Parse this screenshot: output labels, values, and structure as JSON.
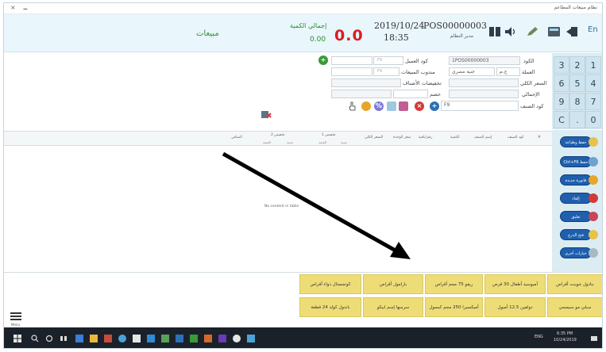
{
  "window": {
    "title": "نظام مبيعات المطاعم",
    "controls": [
      "×",
      "🗕"
    ]
  },
  "header": {
    "language_button": "En",
    "pos_id": "POS00000003",
    "pos_user": "مدير النظام",
    "date": "2019/10/24",
    "time": "18:35",
    "grand_total": "0.0",
    "total_qty_label": "إجمالي الكمية",
    "total_qty": "0.00",
    "screen_title": "مبيعات"
  },
  "numpad": {
    "keys": [
      "1",
      "2",
      "3",
      "4",
      "5",
      "6",
      "7",
      "8",
      "9",
      "0",
      ".",
      "C"
    ]
  },
  "form": {
    "code_label": "الكود",
    "code_value": "1POS00000003",
    "customer_code_label": "كود العميل",
    "currency_label": "العملة",
    "currency_value": "جنية مصري",
    "currency_code": "ج.م",
    "sales_rep_label": "مندوب المبيعات",
    "total_price_label": "السعر الكلي",
    "item_discounts_label": "تخفيضات الأصناف",
    "total_label": "الإجمالي",
    "discount_label": "خصم",
    "item_code_label": "كود الصنف",
    "hint_text": "F9"
  },
  "grid": {
    "columns": [
      "#",
      "كود الصنف",
      "إسم الصنف",
      "الكمية",
      "رقم/باقية",
      "سعر الوحدة",
      "السعر الكلي",
      "تخفيض 1",
      "تخفيض 2",
      "الصافي"
    ],
    "sub_columns": [
      "نسبة",
      "القيمة"
    ],
    "empty_message": "No content in table"
  },
  "side_buttons": [
    {
      "label": "حفظ وطباعة"
    },
    {
      "label": "Ctrl+F6 حفظ"
    },
    {
      "label": "فاتورة جديدة"
    },
    {
      "label": "إلغاء"
    },
    {
      "label": "تعليق"
    },
    {
      "label": "فتح الدرج"
    },
    {
      "label": "خيارات أخرى"
    }
  ],
  "tiles": {
    "row1": [
      "بنادول جوينت أقراص",
      "أميوسيد أطفال 30 قرص",
      "ريفو 75 مجم أقراص",
      "بارامول أقراص",
      "كونجستال دواء أقراص"
    ],
    "row2": [
      "سبلي مو سيمسي",
      "دولفين 12.5 أمبول",
      "أميكسيرا 250 مجم كبسول",
      "سرسها إسم ابيكو",
      "باندول كولد 24 قطعة"
    ]
  },
  "menu_label": "Menu",
  "taskbar": {
    "clock_time": "6:35 PM",
    "clock_date": "10/24/2019",
    "lang": "ENG"
  },
  "colors": {
    "header_bg": "#e9f6fc",
    "total_red": "#d62020",
    "qty_green": "#2b8f2b",
    "tile_yellow": "#eedd77",
    "side_button_blue": "#1f5fae",
    "taskbar": "#1b2129"
  }
}
